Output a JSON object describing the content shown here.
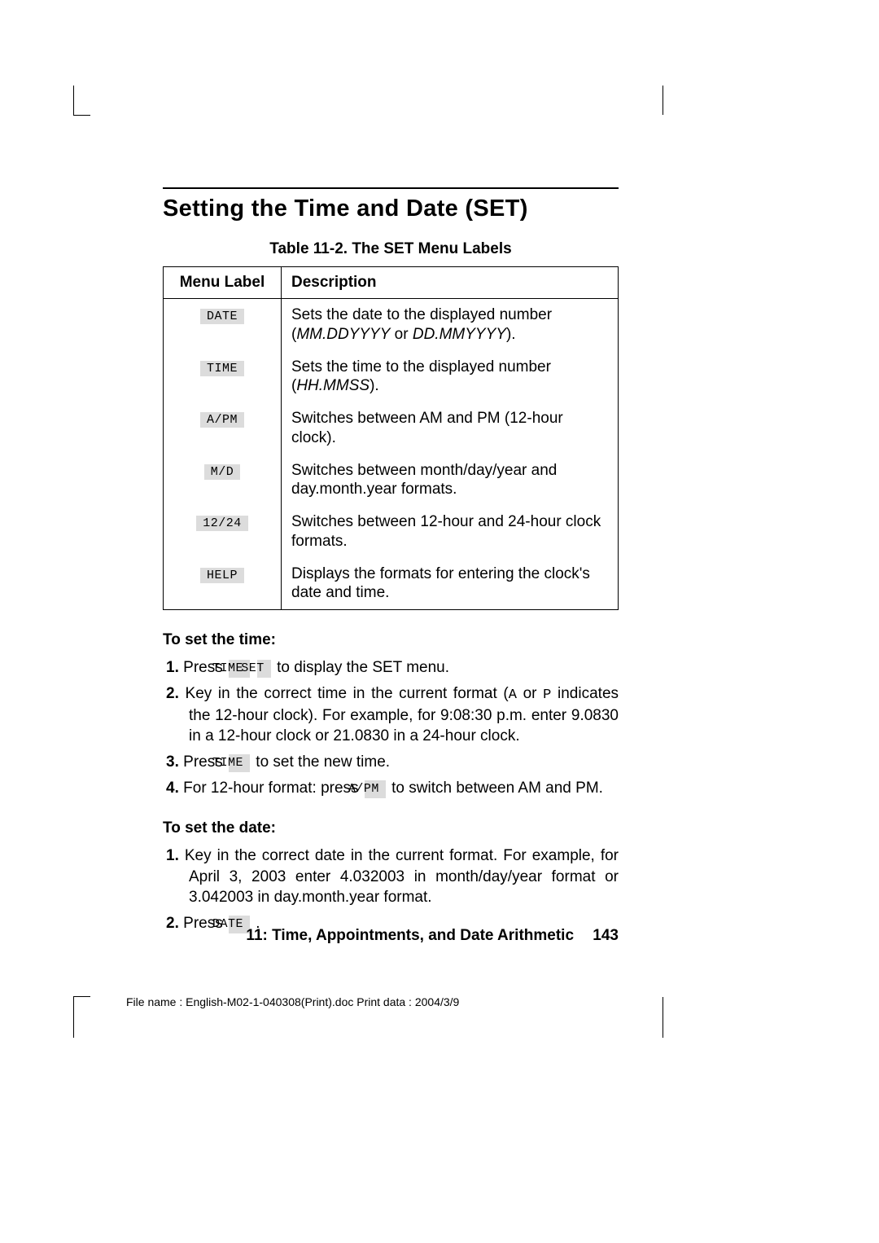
{
  "section_title": "Setting the Time and Date (SET)",
  "table_caption": "Table 11-2. The SET Menu Labels",
  "table": {
    "head": {
      "col1": "Menu Label",
      "col2": "Description"
    },
    "rows": [
      {
        "label": "DATE",
        "desc_pre": "Sets the date to the displayed number (",
        "desc_em1": "MM.DDYYYY",
        "desc_mid": " or ",
        "desc_em2": "DD.MMYYYY",
        "desc_post": ")."
      },
      {
        "label": "TIME",
        "desc_pre": "Sets the time to the displayed number (",
        "desc_em1": "HH.MMSS",
        "desc_post": ")."
      },
      {
        "label": "A/PM",
        "desc": "Switches between AM and PM (12-hour clock)."
      },
      {
        "label": "M/D",
        "desc": "Switches between month/day/year and day.month.year formats."
      },
      {
        "label": "12/24",
        "desc": "Switches between 12-hour and 24-hour clock formats."
      },
      {
        "label": "HELP",
        "desc": "Displays the formats for entering the clock's date and time."
      }
    ]
  },
  "set_time_head": "To set the time:",
  "set_time_steps": {
    "s1_pre": "Press ",
    "s1_key1": "TIME",
    "s1_key2": "SET",
    "s1_post": " to display the SET menu.",
    "s2_a": "Key in the correct time in the current format (",
    "s2_A": "A",
    "s2_b": " or ",
    "s2_P": "P",
    "s2_c": " indicates the 12-hour clock). For example, for 9:08:30 p.m. enter 9.0830 in a 12-hour clock or 21.0830 in a 24-hour clock.",
    "s3_pre": "Press ",
    "s3_key": "TIME",
    "s3_post": " to set the new time.",
    "s4_pre": "For 12-hour format: press ",
    "s4_key": "A/PM",
    "s4_post": " to switch between AM and PM."
  },
  "set_date_head": "To set the date:",
  "set_date_steps": {
    "s1": "Key in the correct date in the current format. For example, for April 3, 2003 enter 4.032003 in month/day/year format or 3.042003 in day.month.year format.",
    "s2_pre": "Press ",
    "s2_key": "DATE",
    "s2_post": " ."
  },
  "footer": {
    "chapter": "11: Time, Appointments, and Date Arithmetic",
    "page": "143"
  },
  "print_info": "File name : English-M02-1-040308(Print).doc    Print data : 2004/3/9",
  "nums": {
    "n1": "1.",
    "n2": "2.",
    "n3": "3.",
    "n4": "4."
  }
}
